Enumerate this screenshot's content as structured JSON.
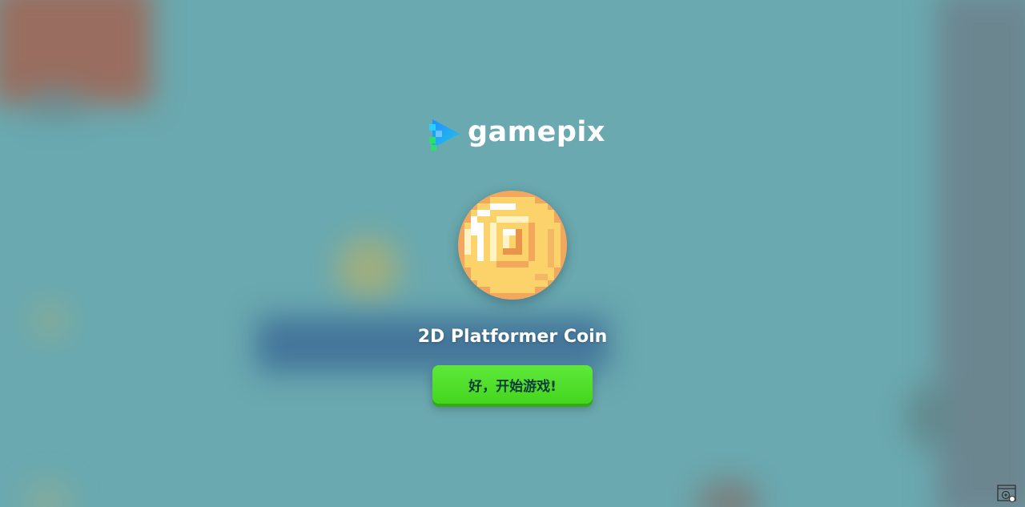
{
  "brand": {
    "name": "gamepix",
    "icon": "gamepix-logo-icon"
  },
  "game": {
    "title": "2D Platformer Coin",
    "thumbnail_icon": "pixel-coin-icon"
  },
  "play_button": {
    "label": "好，开始游戏!"
  },
  "corner_widget": {
    "icon": "settings-window-icon"
  },
  "colors": {
    "background": "#6aa9b0",
    "button_green": "#4ee02a",
    "button_text": "#0e3a3a",
    "brand_text": "#ffffff",
    "logo_blue": "#1e90ff",
    "logo_green": "#2ee06a"
  }
}
